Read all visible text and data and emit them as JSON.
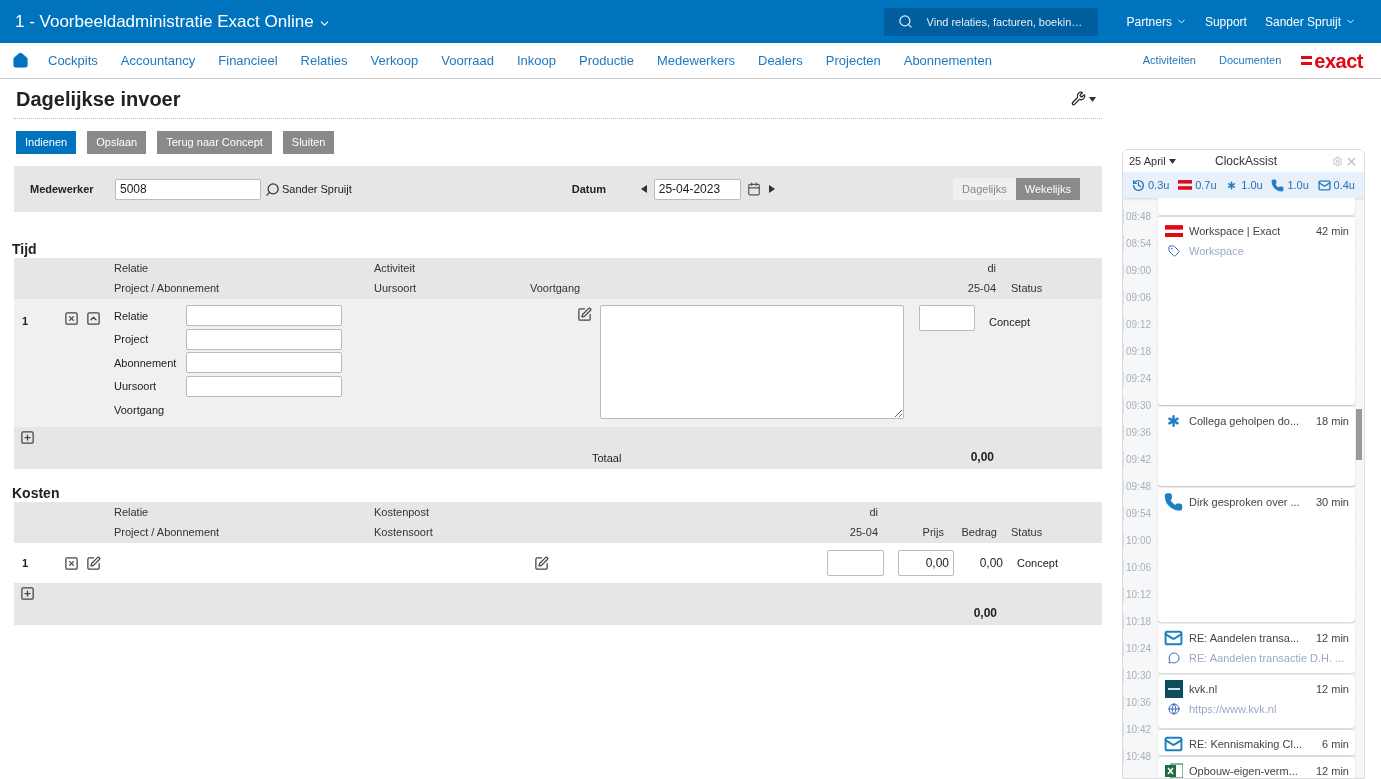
{
  "header": {
    "company": "1 - Voorbeeldadministratie Exact Online",
    "search": {
      "placeholder": "Vind relaties, facturen, boekin…"
    },
    "links": [
      {
        "label": "Partners",
        "dropdown": true
      },
      {
        "label": "Support",
        "dropdown": false
      },
      {
        "label": "Sander Spruijt",
        "dropdown": true
      }
    ]
  },
  "nav": {
    "items": [
      "Cockpits",
      "Accountancy",
      "Financieel",
      "Relaties",
      "Verkoop",
      "Voorraad",
      "Inkoop",
      "Productie",
      "Medewerkers",
      "Dealers",
      "Projecten",
      "Abonnementen"
    ],
    "right_links": [
      "Activiteiten",
      "Documenten"
    ],
    "logo": "exact"
  },
  "page": {
    "title": "Dagelijkse invoer",
    "buttons": [
      {
        "label": "Indienen",
        "primary": true
      },
      {
        "label": "Opslaan",
        "primary": false
      },
      {
        "label": "Terug naar Concept",
        "primary": false
      },
      {
        "label": "Sluiten",
        "primary": false
      }
    ]
  },
  "filter": {
    "employee_label": "Medewerker",
    "employee_value": "5008",
    "employee_name": "Sander Spruijt",
    "date_label": "Datum",
    "date_value": "25-04-2023",
    "views": [
      {
        "label": "Dagelijks",
        "selected": false
      },
      {
        "label": "Wekelijks",
        "selected": true
      }
    ]
  },
  "time_section": {
    "title": "Tijd",
    "header_row_1": [
      "Relatie",
      "Activiteit",
      "di"
    ],
    "header_row_2": [
      "Project / Abonnement",
      "Uursoort",
      "Voortgang",
      "25-04",
      "Status"
    ],
    "rows": [
      {
        "number": "1",
        "fields": [
          "Relatie",
          "Project",
          "Abonnement",
          "Uursoort"
        ],
        "progress_label": "Voortgang",
        "status": "Concept"
      }
    ],
    "total_label": "Totaal",
    "total": "0,00"
  },
  "costs_section": {
    "title": "Kosten",
    "header_row_1": [
      "Relatie",
      "Kostenpost",
      "di"
    ],
    "header_row_2": [
      "Project / Abonnement",
      "Kostensoort",
      "25-04",
      "Prijs",
      "Bedrag",
      "Status"
    ],
    "rows": [
      {
        "number": "1",
        "price": "0,00",
        "amount": "0,00",
        "status": "Concept"
      }
    ],
    "total": "0,00"
  },
  "clock_assist": {
    "date": "25 April",
    "title": "ClockAssist",
    "summary": [
      {
        "kind": "history",
        "value": "0.3u"
      },
      {
        "kind": "exact",
        "value": "0.7u"
      },
      {
        "kind": "asterisk",
        "value": "1.0u"
      },
      {
        "kind": "phone",
        "value": "1.0u"
      },
      {
        "kind": "mail",
        "value": "0.4u"
      }
    ],
    "times": [
      "08:48",
      "08:54",
      "09:00",
      "09:06",
      "09:12",
      "09:18",
      "09:24",
      "09:30",
      "09:36",
      "09:42",
      "09:48",
      "09:54",
      "10:00",
      "10:06",
      "10:12",
      "10:18",
      "10:24",
      "10:30",
      "10:36",
      "10:42",
      "10:48"
    ],
    "events": [
      {
        "kind": "exact",
        "title": "Workspace | Exact",
        "duration": "42 min",
        "detail": {
          "kind": "tag",
          "text": "Workspace"
        }
      },
      {
        "kind": "asterisk",
        "title": "Collega geholpen do...",
        "duration": "18 min"
      },
      {
        "kind": "phone",
        "title": "Dirk gesproken over ...",
        "duration": "30 min"
      },
      {
        "kind": "mail",
        "title": "RE: Aandelen transa...",
        "duration": "12 min",
        "detail": {
          "kind": "comment",
          "text": "RE: Aandelen transactie D.H. ..."
        }
      },
      {
        "kind": "kvk",
        "title": "kvk.nl",
        "duration": "12 min",
        "detail": {
          "kind": "globe",
          "text": "https://www.kvk.nl"
        }
      },
      {
        "kind": "mail",
        "title": "RE: Kennismaking Cl...",
        "duration": "6 min"
      },
      {
        "kind": "excel",
        "title": "Opbouw-eigen-verm...",
        "duration": "12 min"
      }
    ]
  }
}
